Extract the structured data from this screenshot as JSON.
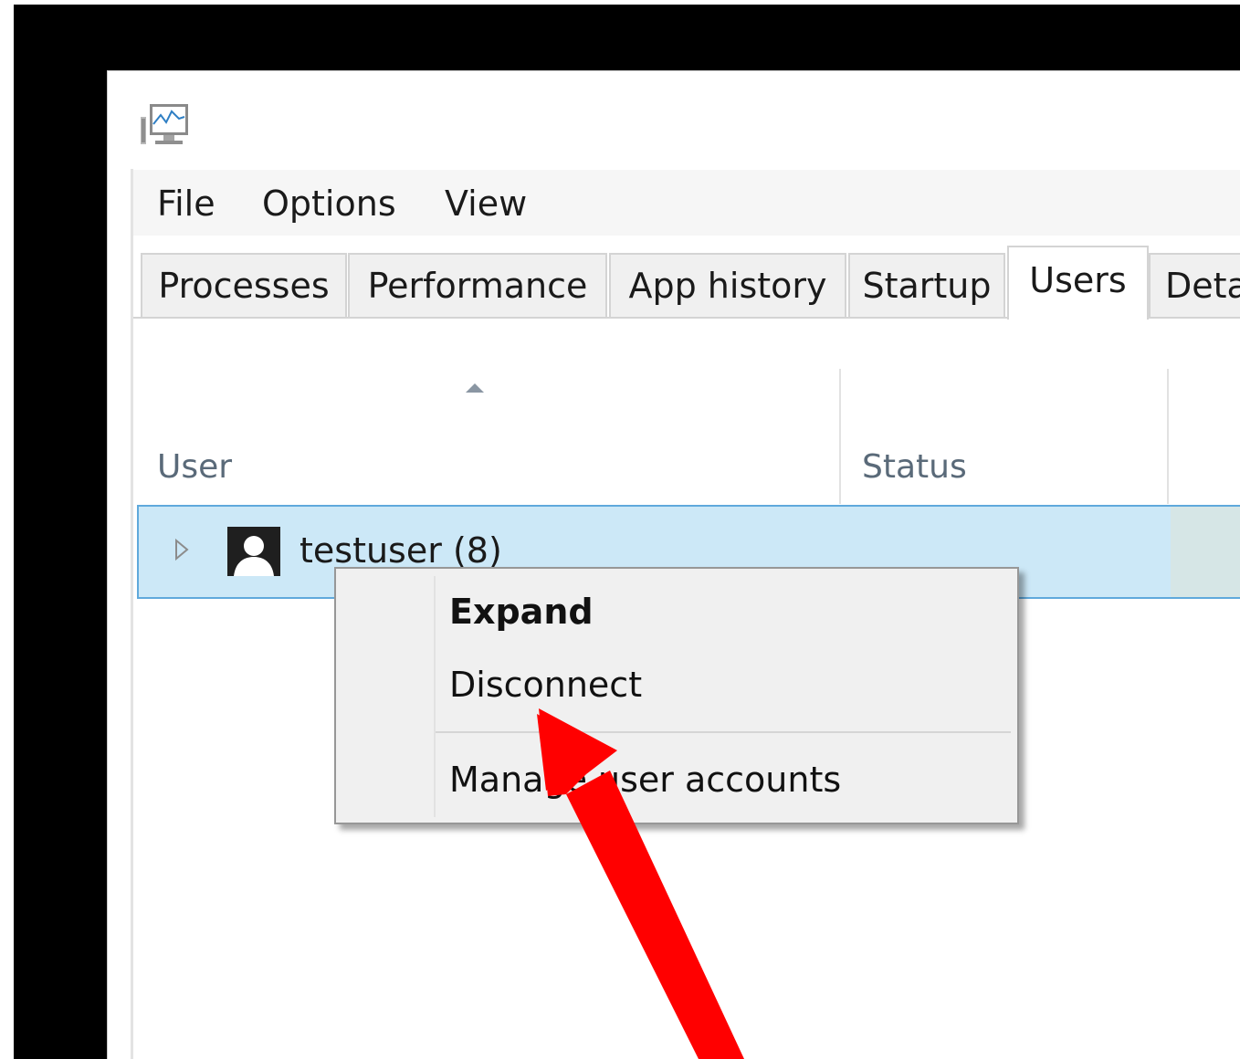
{
  "menubar": {
    "items": [
      {
        "label": "File"
      },
      {
        "label": "Options"
      },
      {
        "label": "View"
      }
    ]
  },
  "tabs": [
    {
      "label": "Processes"
    },
    {
      "label": "Performance"
    },
    {
      "label": "App history"
    },
    {
      "label": "Startup"
    },
    {
      "label": "Users",
      "active": true
    },
    {
      "label": "Deta"
    }
  ],
  "table": {
    "columns": [
      {
        "label": "User"
      },
      {
        "label": "Status"
      }
    ],
    "rows": [
      {
        "label": "testuser (8)",
        "selected": true,
        "icon": "user-avatar-icon"
      }
    ]
  },
  "context_menu": {
    "items": [
      {
        "label": "Expand",
        "default": true
      },
      {
        "label": "Disconnect"
      },
      {
        "label": "Manage user accounts"
      }
    ]
  },
  "colors": {
    "selection_fill": "#cce8f7",
    "selection_border": "#5fa9dc",
    "annotation_arrow": "#ff0000",
    "header_text": "#5a6a79"
  },
  "icons": {
    "app": "task-manager-icon",
    "sort": "sort-ascending-icon",
    "expander": "expand-triangle-icon"
  }
}
